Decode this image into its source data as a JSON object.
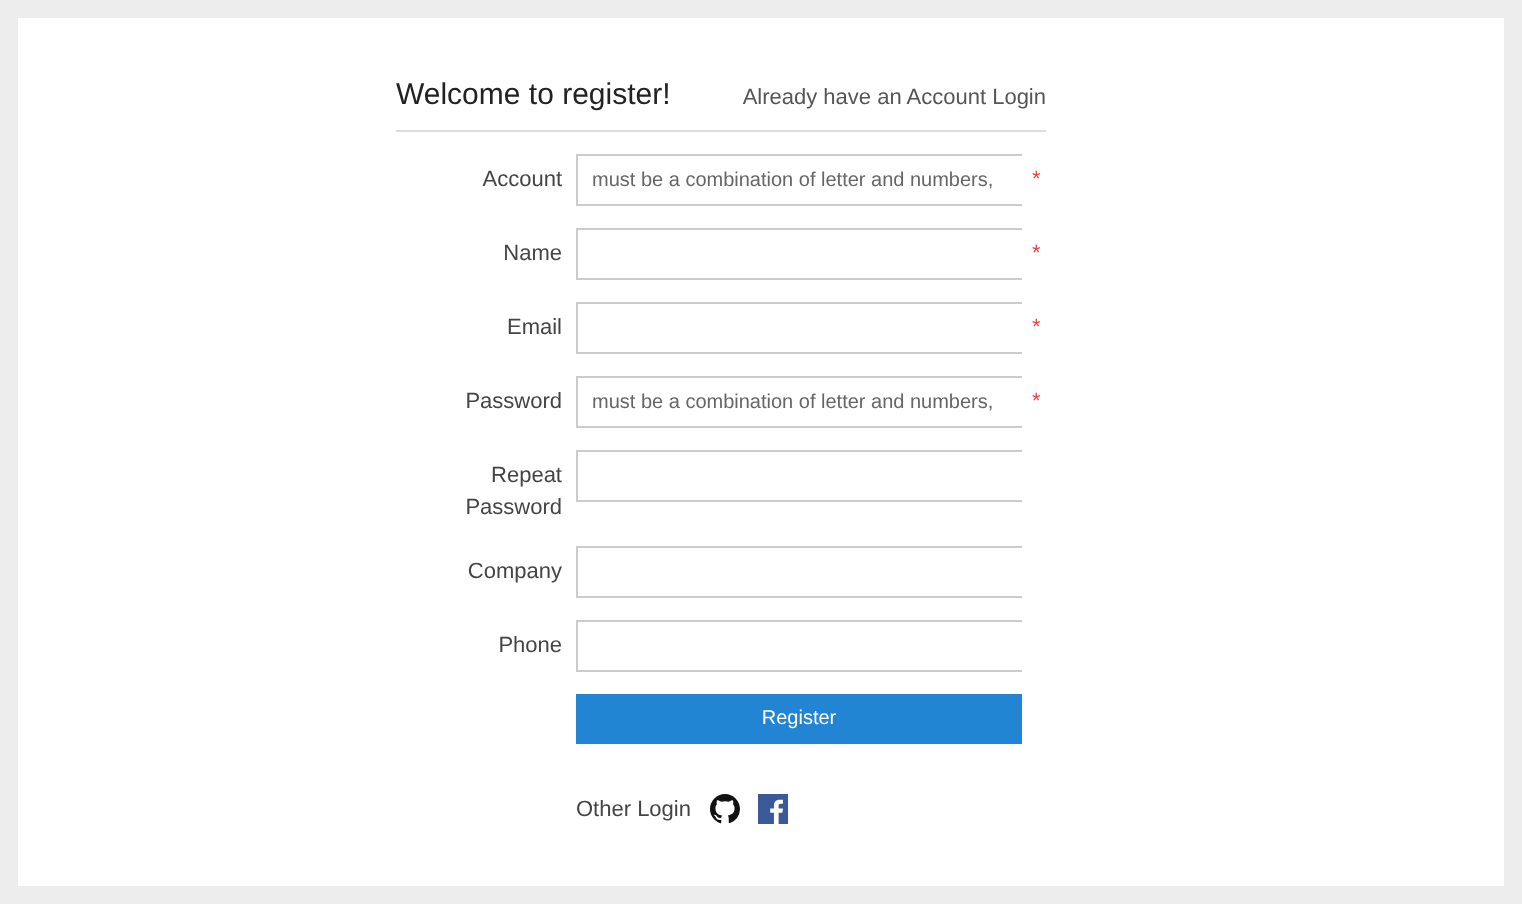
{
  "header": {
    "title": "Welcome to register!",
    "login_link": "Already have an Account Login"
  },
  "fields": [
    {
      "label": "Account",
      "placeholder": "must be a combination of letter and numbers,",
      "required_mark": "*"
    },
    {
      "label": "Name",
      "required_mark": "*"
    },
    {
      "label": "Email",
      "required_mark": "*"
    },
    {
      "label": "Password",
      "placeholder": "must be a combination of letter and numbers,",
      "required_mark": "*"
    },
    {
      "label": "Repeat Password"
    },
    {
      "label": "Company"
    },
    {
      "label": "Phone"
    }
  ],
  "register_button": "Register",
  "other_login": {
    "label": "Other Login",
    "providers": [
      {
        "kind": "github"
      },
      {
        "kind": "facebook"
      }
    ]
  }
}
